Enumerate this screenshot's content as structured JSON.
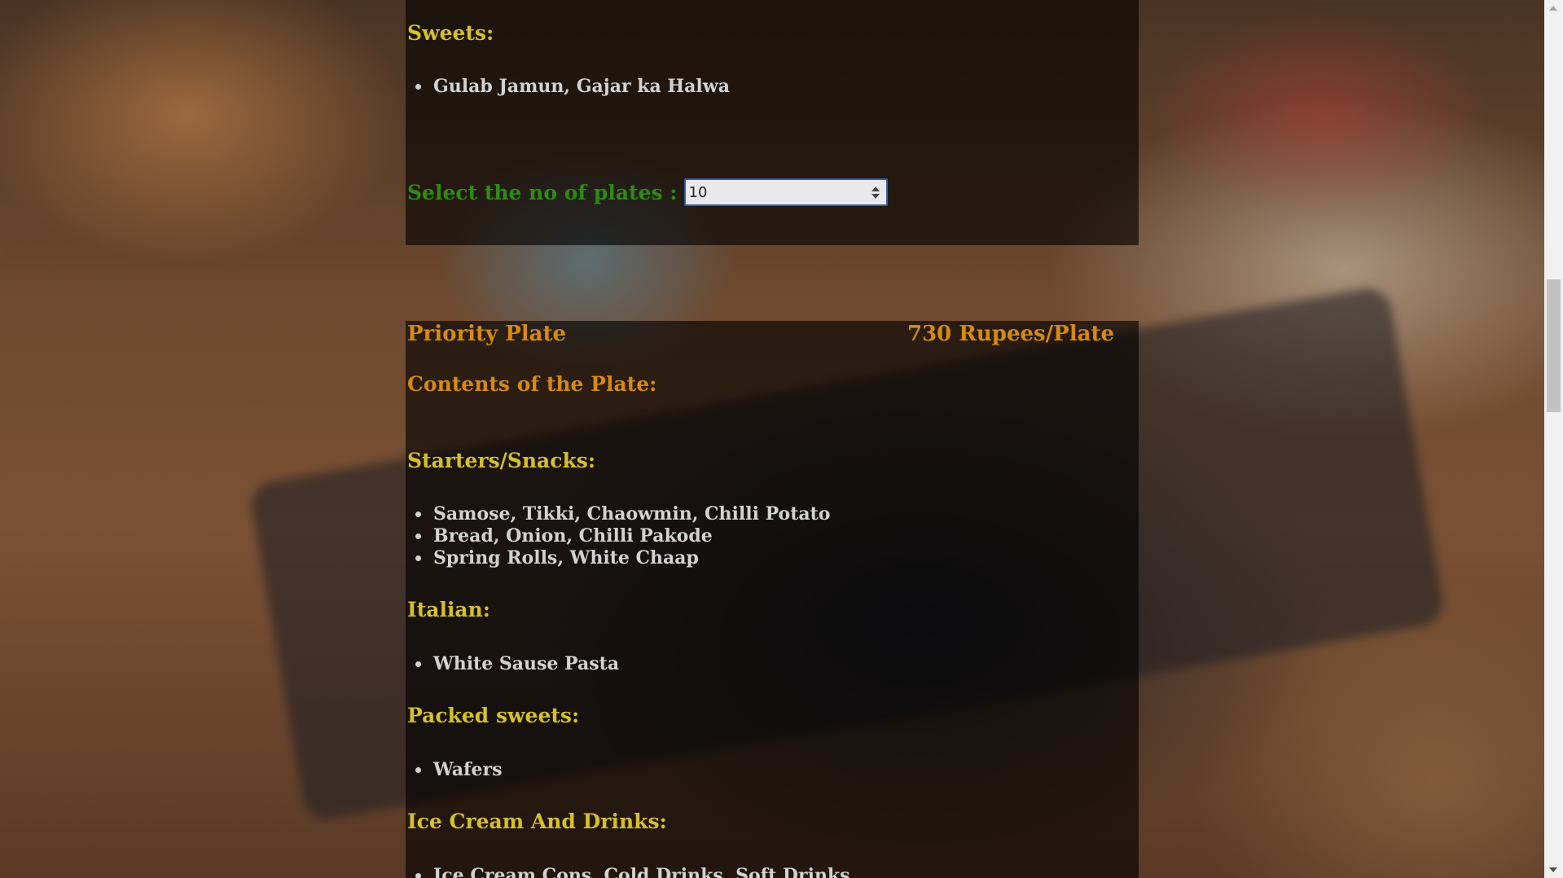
{
  "first_plate": {
    "sweets_heading": "Sweets:",
    "sweets_items": [
      "Gulab Jamun, Gajar ka Halwa"
    ],
    "plates_label": "Select the no of plates :",
    "plates_value": "10"
  },
  "priority_plate": {
    "title": "Priority Plate",
    "price": "730 Rupees/Plate",
    "contents_heading": "Contents of the Plate:",
    "starters_heading": "Starters/Snacks:",
    "starters_items": [
      "Samose, Tikki, Chaowmin, Chilli Potato",
      "Bread, Onion, Chilli Pakode",
      "Spring Rolls, White Chaap"
    ],
    "italian_heading": "Italian:",
    "italian_items": [
      "White Sause Pasta"
    ],
    "packed_heading": "Packed sweets:",
    "packed_items": [
      "Wafers"
    ],
    "icecream_heading": "Ice Cream And Drinks:",
    "icecream_items": [
      "Ice Cream Cons, Cold Drinks, Soft Drinks"
    ]
  },
  "colors": {
    "section_heading": "#d4c02c",
    "plate_title": "#d48a14",
    "plates_label": "#2f8a14",
    "list_text": "#d2d2d2",
    "input_border": "#2e5fa8"
  },
  "icons": {
    "spinner": "up-down-arrows",
    "scroll_up": "triangle-up",
    "scroll_down": "triangle-down"
  }
}
